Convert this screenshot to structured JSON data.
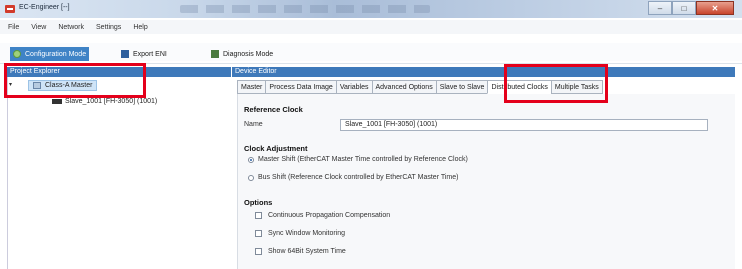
{
  "window": {
    "title": "EC-Engineer [--]",
    "minimize_glyph": "–",
    "maximize_glyph": "□",
    "close_glyph": "✕"
  },
  "menu": [
    "File",
    "View",
    "Network",
    "Settings",
    "Help"
  ],
  "toolbar": {
    "config_mode": "Configuration Mode",
    "export_eni": "Export ENI",
    "diagnosis_mode": "Diagnosis Mode"
  },
  "project_explorer": {
    "title": "Project Explorer",
    "toggle": "▾",
    "master_node": "Class-A Master",
    "slave_node": "Slave_1001 [FH-3050] (1001)"
  },
  "device_editor": {
    "title": "Device Editor",
    "tabs": [
      "Master",
      "Process Data Image",
      "Variables",
      "Advanced Options",
      "Slave to Slave",
      "Distributed Clocks",
      "Multiple Tasks"
    ],
    "active_tab": "Distributed Clocks",
    "reference_clock": {
      "heading": "Reference Clock",
      "name_label": "Name",
      "name_value": "Slave_1001 [FH-3050] (1001)"
    },
    "clock_adjustment": {
      "heading": "Clock Adjustment",
      "master_shift": "Master Shift (EtherCAT Master Time controlled by Reference Clock)",
      "bus_shift": "Bus Shift (Reference Clock controlled by EtherCAT Master Time)"
    },
    "options": {
      "heading": "Options",
      "continuous_propagation": "Continuous Propagation Compensation",
      "sync_window": "Sync Window Monitoring",
      "show_64bit": "Show 64Bit System Time"
    }
  },
  "colors": {
    "accent_blue": "#3e79ba",
    "annotation_red": "#e4001b"
  }
}
